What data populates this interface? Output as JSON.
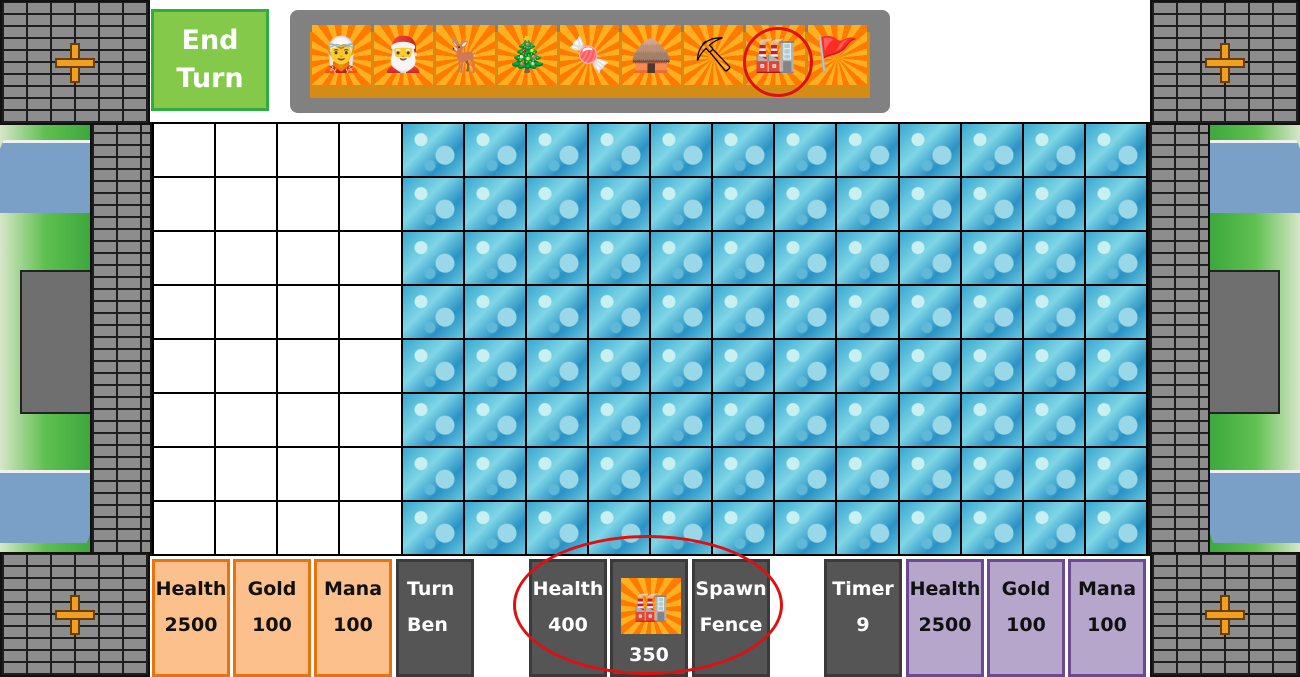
{
  "end_turn": {
    "line1": "End",
    "line2": "Turn"
  },
  "tray": {
    "cards": [
      {
        "icon": "elf-icon",
        "glyph": "🧝"
      },
      {
        "icon": "santa-icon",
        "glyph": "🎅"
      },
      {
        "icon": "reindeer-icon",
        "glyph": "🦌"
      },
      {
        "icon": "christmas-trees-icon",
        "glyph": "🎄"
      },
      {
        "icon": "candy-cane-fence-icon",
        "glyph": "🍬"
      },
      {
        "icon": "igloo-icon",
        "glyph": "🛖"
      },
      {
        "icon": "mine-entrance-icon",
        "glyph": "⛏"
      },
      {
        "icon": "factory-icon",
        "glyph": "🏭"
      },
      {
        "icon": "north-pole-sign-icon",
        "glyph": "🚩"
      }
    ],
    "selected_index": 7
  },
  "player_left": {
    "health_label": "Health",
    "health": "2500",
    "gold_label": "Gold",
    "gold": "100",
    "mana_label": "Mana",
    "mana": "100"
  },
  "turn": {
    "label": "Turn",
    "player": "Ben"
  },
  "selected_unit": {
    "health_label": "Health",
    "health": "400",
    "icon": "factory-icon",
    "glyph": "🏭",
    "cost": "350",
    "spawn_label": "Spawn",
    "spawn_value": "Fence"
  },
  "timer": {
    "label": "Timer",
    "value": "9"
  },
  "player_right": {
    "health_label": "Health",
    "health": "2500",
    "gold_label": "Gold",
    "gold": "100",
    "mana_label": "Mana",
    "mana": "100"
  },
  "board": {
    "rows": 8,
    "cols": 16,
    "empty_cols": 4
  },
  "colors": {
    "player_left": "#fbc08c",
    "player_right": "#b7a6cc",
    "end_turn": "#84c94a",
    "highlight": "#dd1111"
  }
}
